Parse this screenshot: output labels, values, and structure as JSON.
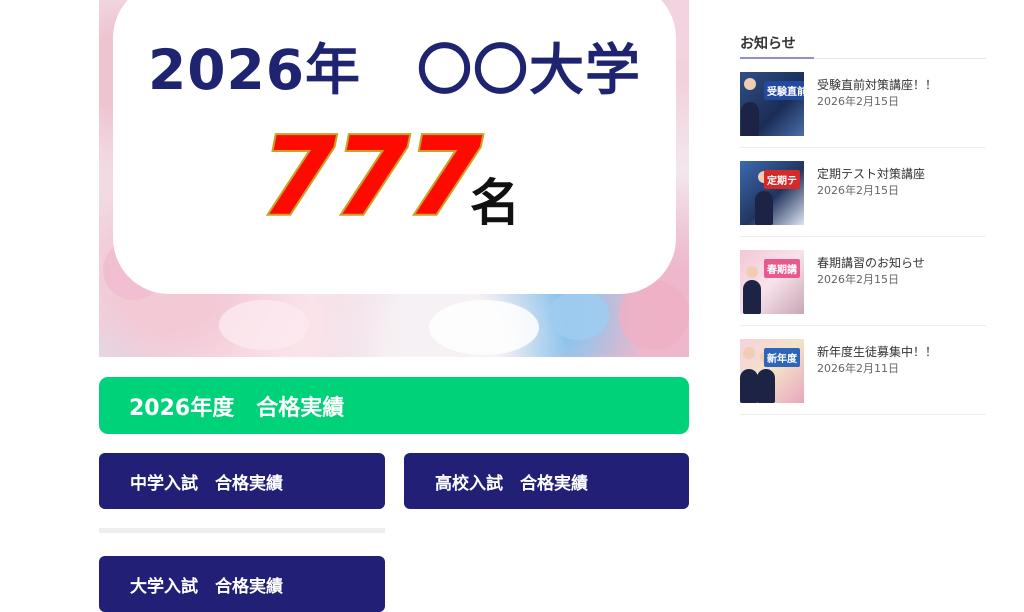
{
  "hero": {
    "title": "2026年　〇〇大学",
    "count": "777",
    "unit": "名"
  },
  "results_bar": {
    "label": "2026年度　合格実績"
  },
  "nav_buttons": {
    "junior_high": "中学入試　合格実績",
    "high_school": "高校入試　合格実績",
    "university": "大学入試　合格実績"
  },
  "sidebar": {
    "heading": "お知らせ",
    "items": [
      {
        "title": "受験直前対策講座！！",
        "date": "2026年2月15日",
        "thumb_text": "受験直前",
        "thumb_icon": "exam-prep-thumbnail"
      },
      {
        "title": "定期テスト対策講座",
        "date": "2026年2月15日",
        "thumb_text": "定期テ",
        "thumb_icon": "test-prep-thumbnail"
      },
      {
        "title": "春期講習のお知らせ",
        "date": "2026年2月15日",
        "thumb_text": "春期講",
        "thumb_icon": "spring-course-thumbnail"
      },
      {
        "title": "新年度生徒募集中！！",
        "date": "2026年2月11日",
        "thumb_text": "新年度",
        "thumb_icon": "recruitment-thumbnail"
      }
    ]
  },
  "colors": {
    "navy": "#222076",
    "green": "#00d27a",
    "count_red": "#ff0a00",
    "count_outline": "#c9a227"
  }
}
